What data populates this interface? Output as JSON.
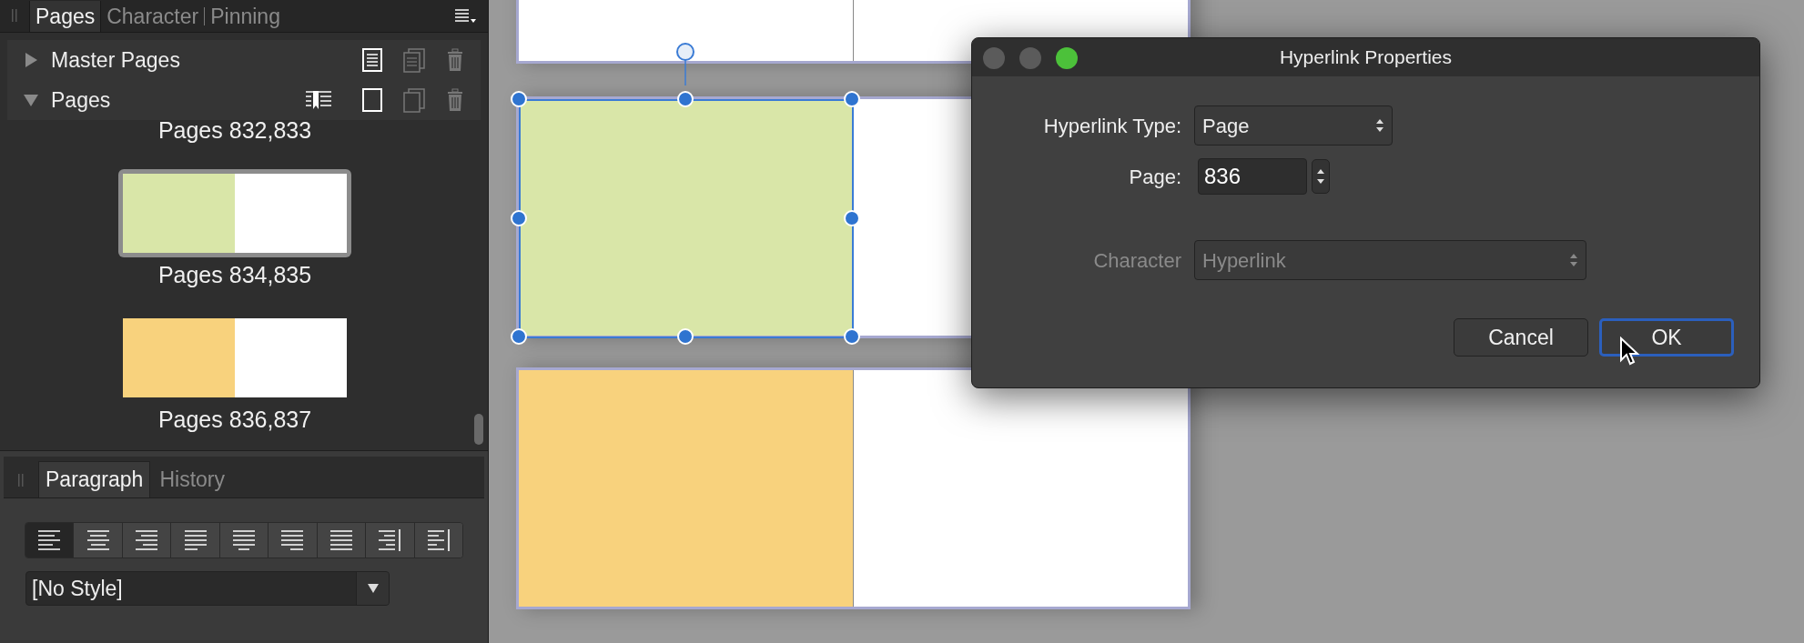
{
  "panel_tabs": [
    {
      "label": "Pages",
      "selected": true
    },
    {
      "label": "Character",
      "selected": false
    },
    {
      "label": "Pinning",
      "selected": false
    }
  ],
  "sections": [
    {
      "label": "Master Pages",
      "expanded": false,
      "kind": "master"
    },
    {
      "label": "Pages",
      "expanded": true,
      "kind": "pages"
    }
  ],
  "page_thumbnails": [
    {
      "label": "Pages 832,833",
      "kind": "label_only"
    },
    {
      "label": "Pages 834,835",
      "kind": "spread",
      "color": "#d9e6a8",
      "selected": true
    },
    {
      "label": "Pages 836,837",
      "kind": "spread",
      "color": "#f8d27d",
      "selected": false
    }
  ],
  "bottom_tabs": [
    {
      "label": "Paragraph",
      "selected": true
    },
    {
      "label": "History",
      "selected": false
    }
  ],
  "alignment_buttons": [
    {
      "kind": "left",
      "selected": true
    },
    {
      "kind": "center",
      "selected": false
    },
    {
      "kind": "right",
      "selected": false
    },
    {
      "kind": "justify_left",
      "selected": false
    },
    {
      "kind": "justify_center",
      "selected": false
    },
    {
      "kind": "justify_right",
      "selected": false
    },
    {
      "kind": "justify_all",
      "selected": false
    },
    {
      "kind": "towards_spine",
      "selected": false
    },
    {
      "kind": "away_from_spine",
      "selected": false
    }
  ],
  "paragraph_style": {
    "value": "[No Style]"
  },
  "spreads": [
    {
      "color": "#ffffff",
      "selected": false
    },
    {
      "color": "#d9e6a8",
      "selected": true
    },
    {
      "color": "#f8d27d",
      "selected": false
    }
  ],
  "dialog": {
    "title": "Hyperlink Properties",
    "fields": [
      {
        "label": "Hyperlink Type:",
        "value": "Page",
        "kind": "popup",
        "disabled": false
      },
      {
        "label": "Page:",
        "value": "836",
        "kind": "stepper",
        "disabled": false
      },
      {
        "label": "Character",
        "value": "Hyperlink",
        "kind": "popup",
        "disabled": true
      }
    ],
    "buttons": [
      {
        "label": "Cancel",
        "default": false
      },
      {
        "label": "OK",
        "default": true
      }
    ]
  }
}
